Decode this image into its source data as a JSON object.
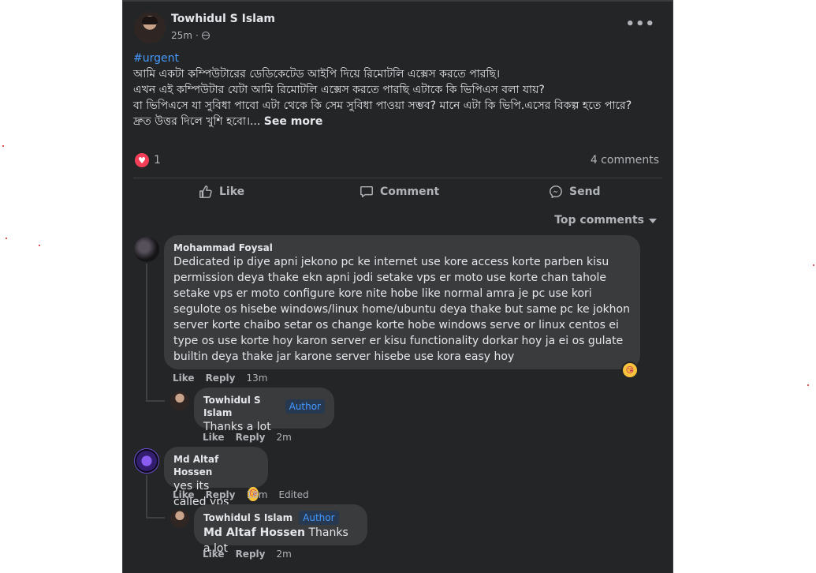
{
  "post": {
    "author": "Towhidul S Islam",
    "time": "25m",
    "meta_sep": "·",
    "more_label": "•••",
    "hashtag": "#urgent",
    "lines": [
      "আমি একটা কম্পিউটারের ডেডিকেটেড আইপি দিয়ে রিমোটলি এক্সেস করতে পারছি।",
      "এখন এই কম্পিউটার যেটা আমি রিমোটলি এক্সেস করতে পারছি এটাকে কি ভিপিএস বলা যায়?",
      "বা ভিপিএসে যা সুবিধা পাবো এটা থেকে কি সেম সুবিধা পাওয়া সম্ভব? মানে এটা কি ভিপি.এসের বিকল্প হতে পারে?",
      "দ্রুত উত্তর দিলে খুশি হবো।..."
    ],
    "see_more": "See more",
    "reaction_count": "1",
    "comments_count": "4 comments"
  },
  "actions": {
    "like": "Like",
    "comment": "Comment",
    "send": "Send"
  },
  "sort_label": "Top comments",
  "comments": [
    {
      "author": "Mohammad Foysal",
      "text": "Dedicated ip diye apni jekono pc ke internet use kore access korte parben kisu permission deya thake ekn apni jodi setake vps er moto use korte chan tahole setake vps er moto configure kore nite hobe like normal amra je pc use kori segulote os hisebe windows/linux home/ubuntu deya thake but same pc ke jokhon server korte chaibo setar os change korte hobe windows serve or linux centos ei type os use korte hoy karon server er kisu functionality dorkar hoy ja ei os gulate builtin deya thake jar karone server hisebe use kora easy hoy",
      "like": "Like",
      "reply": "Reply",
      "time": "13m",
      "reply_item": {
        "author": "Towhidul S Islam",
        "badge": "Author",
        "text": "Thanks a lot",
        "like": "Like",
        "reply": "Reply",
        "time": "2m"
      }
    },
    {
      "author": "Md Altaf Hossen",
      "text": "yes its called vps",
      "like": "Like",
      "reply": "Reply",
      "time": "18m",
      "edited": "Edited",
      "reply_item": {
        "author": "Towhidul S Islam",
        "badge": "Author",
        "mention": "Md Altaf Hossen",
        "text": "Thanks a lot",
        "like": "Like",
        "reply": "Reply",
        "time": "2m"
      }
    }
  ],
  "colors": {
    "panel": "#242526",
    "bubble": "#3a3b3c",
    "link": "#4599ff",
    "love": "#f33e58"
  }
}
